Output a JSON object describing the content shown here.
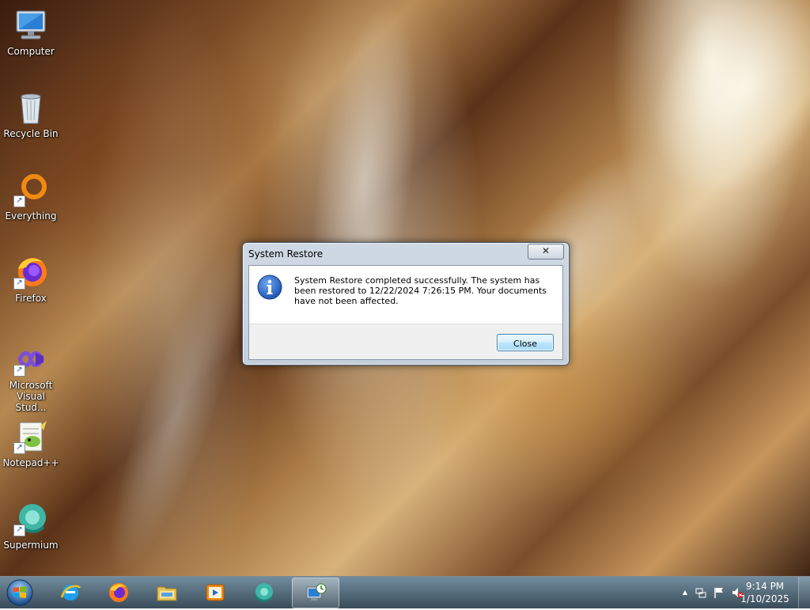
{
  "desktop": {
    "icons": [
      {
        "label": "Computer",
        "icon": "computer-icon"
      },
      {
        "label": "Recycle Bin",
        "icon": "recycle-bin-icon"
      },
      {
        "label": "Everything",
        "icon": "everything-icon"
      },
      {
        "label": "Firefox",
        "icon": "firefox-icon"
      },
      {
        "label": "Microsoft Visual Stud...",
        "icon": "visual-studio-icon"
      },
      {
        "label": "Notepad++",
        "icon": "notepadpp-icon"
      },
      {
        "label": "Supermium",
        "icon": "supermium-icon"
      }
    ]
  },
  "dialog": {
    "title": "System Restore",
    "close_glyph": "✕",
    "message": "System Restore completed successfully. The system has been restored to 12/22/2024 7:26:15 PM. Your documents have not been affected.",
    "icon": "info-icon",
    "close_button_label": "Close"
  },
  "taskbar": {
    "pinned": [
      {
        "name": "internet-explorer",
        "icon": "ie-icon"
      },
      {
        "name": "firefox",
        "icon": "firefox-icon"
      },
      {
        "name": "file-explorer",
        "icon": "folder-icon"
      },
      {
        "name": "media-player",
        "icon": "media-player-icon"
      },
      {
        "name": "supermium",
        "icon": "supermium-icon"
      },
      {
        "name": "system-restore",
        "icon": "system-restore-icon",
        "active": true
      }
    ],
    "tray": {
      "show_hidden_glyph": "▲",
      "time": "9:14 PM",
      "date": "1/10/2025"
    }
  }
}
